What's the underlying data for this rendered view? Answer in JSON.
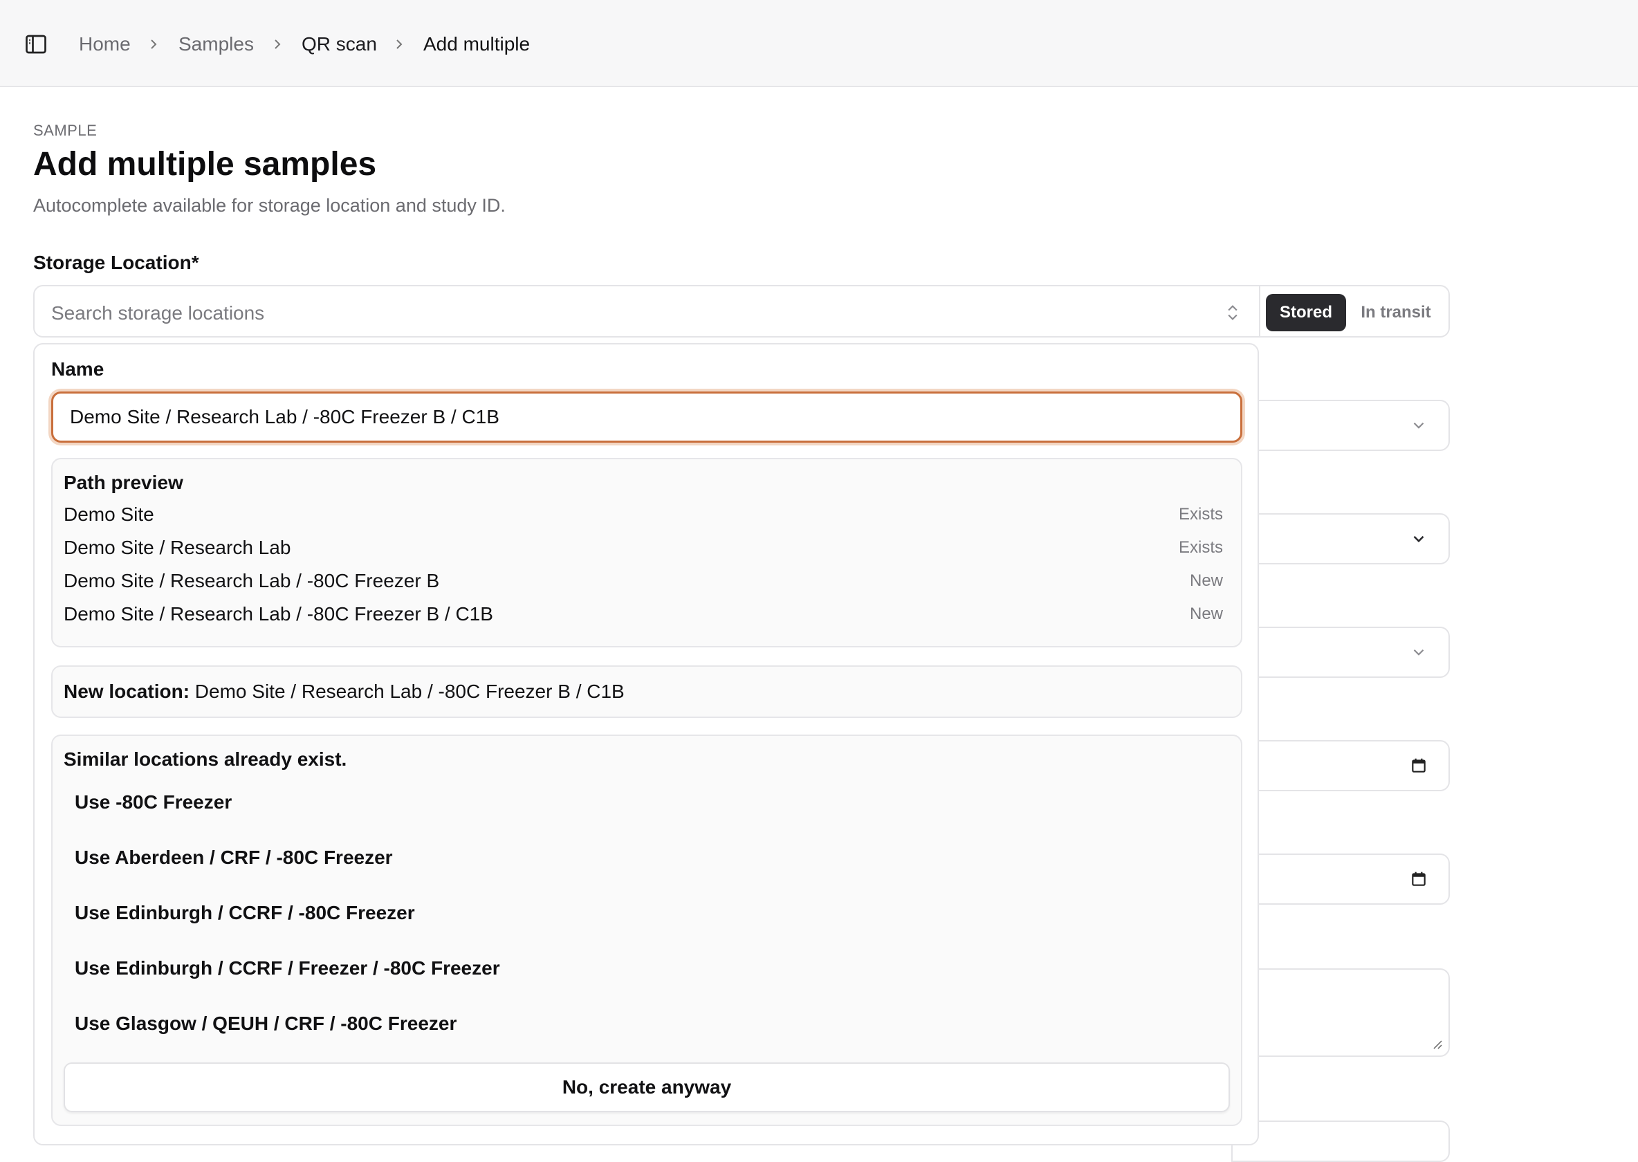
{
  "breadcrumb": {
    "items": [
      "Home",
      "Samples",
      "QR scan",
      "Add multiple"
    ]
  },
  "header": {
    "eyebrow": "SAMPLE",
    "title": "Add multiple samples",
    "subtitle": "Autocomplete available for storage location and study ID."
  },
  "storage": {
    "label": "Storage Location*",
    "search_placeholder": "Search storage locations",
    "status_options": [
      "Stored",
      "In transit"
    ],
    "selected_status": "Stored"
  },
  "panel": {
    "name_label": "Name",
    "name_value": "Demo Site / Research Lab / -80C Freezer B / C1B",
    "preview_title": "Path preview",
    "preview_rows": [
      {
        "path": "Demo Site",
        "status": "Exists"
      },
      {
        "path": "Demo Site / Research Lab",
        "status": "Exists"
      },
      {
        "path": "Demo Site / Research Lab / -80C Freezer B",
        "status": "New"
      },
      {
        "path": "Demo Site / Research Lab / -80C Freezer B / C1B",
        "status": "New"
      }
    ],
    "new_location_label": "New location:",
    "new_location_value": "Demo Site / Research Lab / -80C Freezer B / C1B",
    "similar_title": "Similar locations already exist.",
    "suggestions": [
      "Use -80C Freezer",
      "Use Aberdeen / CRF / -80C Freezer",
      "Use Edinburgh / CCRF / -80C Freezer",
      "Use Edinburgh / CCRF / Freezer / -80C Freezer",
      "Use Glasgow / QEUH / CRF / -80C Freezer"
    ],
    "create_anyway_label": "No, create anyway"
  },
  "colors": {
    "focus_ring": "#c96f3c",
    "selected_segment": "#2a2a2e"
  }
}
